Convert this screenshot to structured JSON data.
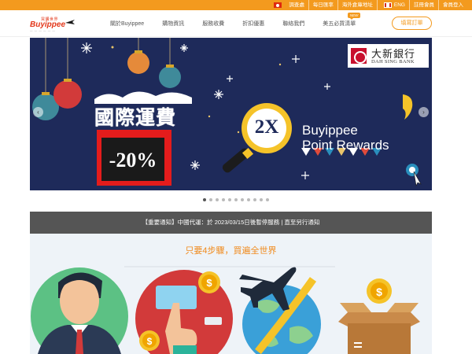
{
  "topbar": {
    "items": [
      "調查處",
      "每日匯率",
      "海外倉庫地址"
    ],
    "lang": "ENG",
    "account": [
      "註冊會員",
      "會員登入"
    ]
  },
  "header": {
    "logo_small": "買購世界",
    "logo_name": "Buyippee",
    "nav": [
      "關於Buyippee",
      "購物資訊",
      "服務收費",
      "折扣優惠",
      "聯絡我們",
      "美五必買清單"
    ],
    "new_badge": "NEW",
    "order_button": "填寫訂單"
  },
  "banner": {
    "promo_title": "國際運費",
    "promo_discount": "-20%",
    "multiplier": "2X",
    "reward_line1": "Buyippee",
    "reward_line2": "Point Rewards",
    "bank_cn": "大新銀行",
    "bank_en": "DAH SING BANK",
    "arrow_left": "‹",
    "arrow_right": "›"
  },
  "carousel": {
    "total": 11,
    "active_index": 0
  },
  "notice": {
    "text": "【重要通知】中國代運：於 2023/03/15日後暫停服務 | 直至另行通知"
  },
  "steps": {
    "title": "只要4步驟，買遍全世界"
  },
  "colors": {
    "accent": "#f39a1e",
    "banner_bg": "#1e2a5a",
    "notice_bg": "#555555",
    "steps_bg": "#eef3f8"
  }
}
